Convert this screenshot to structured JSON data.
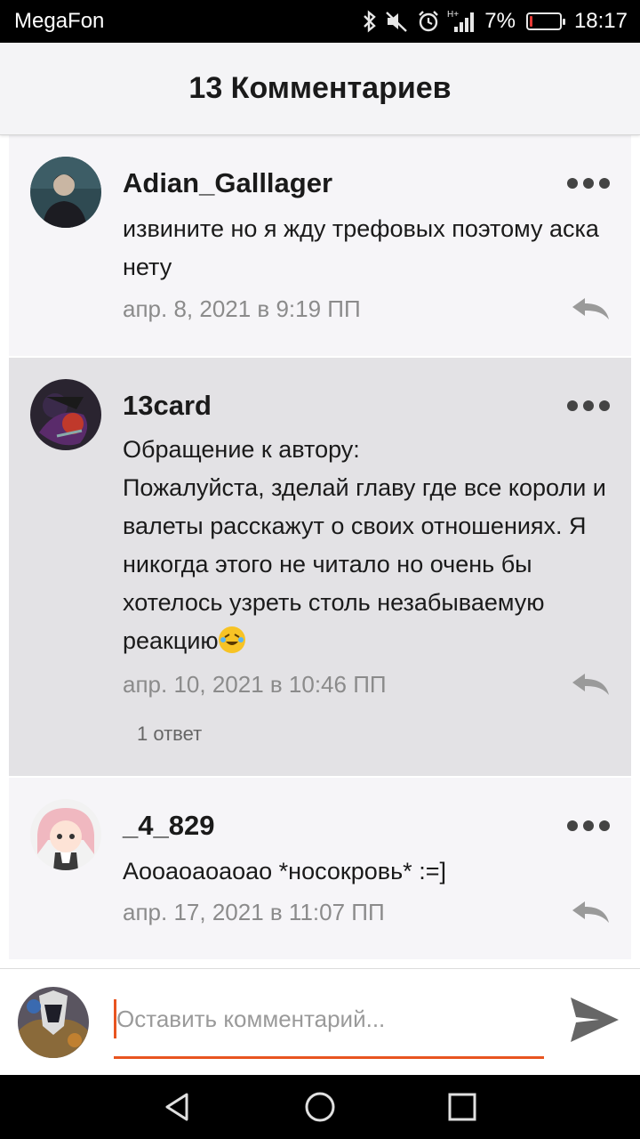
{
  "status_bar": {
    "carrier": "MegaFon",
    "network": "H+",
    "battery_percent": "7%",
    "battery_level": 0.07,
    "time": "18:17",
    "icons": [
      "bluetooth-icon",
      "mute-icon",
      "alarm-icon",
      "signal-icon",
      "battery-icon"
    ]
  },
  "header": {
    "title": "13 Комментариев"
  },
  "comments": [
    {
      "author": "Adian_Galllager",
      "text": "извините но я жду трефовых поэтому аска нету",
      "date": "апр. 8, 2021 в 9:19 ПП"
    },
    {
      "author": "13card",
      "text": "Обращение к автору:\nПожалуйста, зделай главу где все короли и валеты расскажут о своих отношениях. Я никогда этого не читало но очень бы хотелось узреть столь незабываемую реакцию",
      "emoji": "rolling-on-floor-laughing-emoji",
      "date": "апр. 10, 2021 в 10:46 ПП",
      "replies_label": "1 ответ"
    },
    {
      "author": "_4_829",
      "text": "Аооаоаоаоао *носокровь* :=]",
      "date": "апр. 17, 2021 в 11:07 ПП"
    }
  ],
  "composer": {
    "placeholder": "Оставить комментарий..."
  },
  "colors": {
    "accent": "#e8541f",
    "highlight_bg": "#e3e2e5",
    "card_bg": "#f6f5f8"
  }
}
